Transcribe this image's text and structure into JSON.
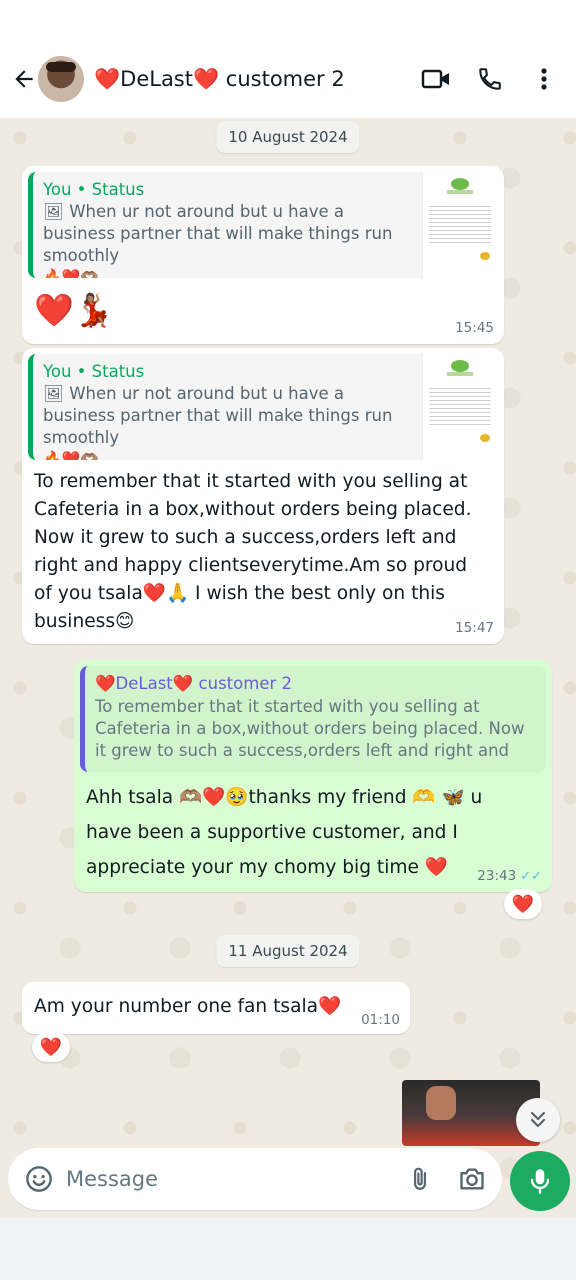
{
  "header": {
    "contact_name": "❤️DeLast❤️ customer 2"
  },
  "icons": {
    "back": "arrow-back-icon",
    "video": "video-call-icon",
    "call": "phone-call-icon",
    "menu": "more-vert-icon",
    "emoji": "emoji-icon",
    "attach": "paperclip-icon",
    "camera": "camera-icon",
    "mic": "mic-icon",
    "scroll": "double-chevron-down-icon"
  },
  "colors": {
    "accent": "#1daa61",
    "outgoing_bubble": "#d9fdd3",
    "incoming_bubble": "#ffffff",
    "read_ticks": "#53bdeb",
    "chat_background": "#efeae2"
  },
  "dates": {
    "first": "10 August 2024",
    "second": "11 August 2024"
  },
  "messages": {
    "m1": {
      "quote_author": "You • Status",
      "quote_text": "🖼 When ur not around but u have a business partner that will make things run smoothly",
      "quote_emoji": "🔥❤️🫶🏽",
      "text": "❤️💃🏽",
      "time": "15:45"
    },
    "m2": {
      "quote_author": "You • Status",
      "quote_text": "🖼 When ur not around but u have a business partner that will make things run smoothly",
      "quote_emoji": "🔥❤️🫶🏽",
      "text": "To remember that it started with you selling at Cafeteria in a box,without orders being placed. Now it grew to such a success,orders left and right and happy clientseverytime.Am so proud of you tsala❤️🙏 I wish the best only on this business😊",
      "time": "15:47"
    },
    "m3": {
      "quote_author": "❤️DeLast❤️ customer 2",
      "quote_text": "To remember that it started with you selling at Cafeteria in a box,without orders being placed. Now it grew to such a success,orders left and right and h...",
      "text": "Ahh tsala 🫶🏽❤️🥹thanks my friend 🫶 🦋 u have been a supportive customer, and I appreciate your my chomy big time ❤️",
      "time": "23:43",
      "ticks": "✓✓",
      "reaction": "❤️"
    },
    "m4": {
      "text": "Am your number one fan tsala❤️",
      "time": "01:10",
      "reaction": "❤️"
    }
  },
  "composer": {
    "placeholder": "Message"
  }
}
